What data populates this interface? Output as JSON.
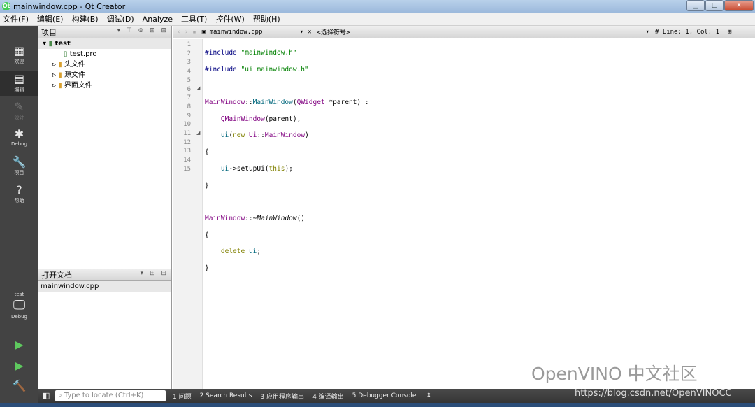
{
  "window": {
    "title": "mainwindow.cpp - Qt Creator",
    "min": "▁",
    "max": "□",
    "close": "✕"
  },
  "menu": [
    "文件(F)",
    "编辑(E)",
    "构建(B)",
    "调试(D)",
    "Analyze",
    "工具(T)",
    "控件(W)",
    "帮助(H)"
  ],
  "modes": [
    {
      "label": "欢迎",
      "icon": "▦"
    },
    {
      "label": "编辑",
      "icon": "▤"
    },
    {
      "label": "设计",
      "icon": "✎"
    },
    {
      "label": "Debug",
      "icon": "✱"
    },
    {
      "label": "项目",
      "icon": "🔧"
    },
    {
      "label": "帮助",
      "icon": "?"
    }
  ],
  "target": {
    "project": "test",
    "config": "Debug"
  },
  "project_panel": {
    "title": "项目",
    "root": "test",
    "items": [
      "test.pro",
      "头文件",
      "源文件",
      "界面文件"
    ]
  },
  "open_docs": {
    "title": "打开文档",
    "files": [
      "mainwindow.cpp"
    ]
  },
  "editor": {
    "file": "mainwindow.cpp",
    "symbol": "<选择符号>",
    "position": "#  Line: 1, Col: 1",
    "line_numbers": [
      "1",
      "2",
      "3",
      "4",
      "5",
      "6",
      "7",
      "8",
      "9",
      "10",
      "11",
      "12",
      "13",
      "14",
      "15"
    ]
  },
  "status": {
    "locate_placeholder": "Type to locate (Ctrl+K)",
    "panes": [
      "1 问题",
      "2 Search Results",
      "3 应用程序输出",
      "4 编译输出",
      "5 Debugger Console"
    ]
  },
  "watermark": "OpenVINO 中文社区",
  "csdn": "https://blog.csdn.net/OpenVINOCC"
}
